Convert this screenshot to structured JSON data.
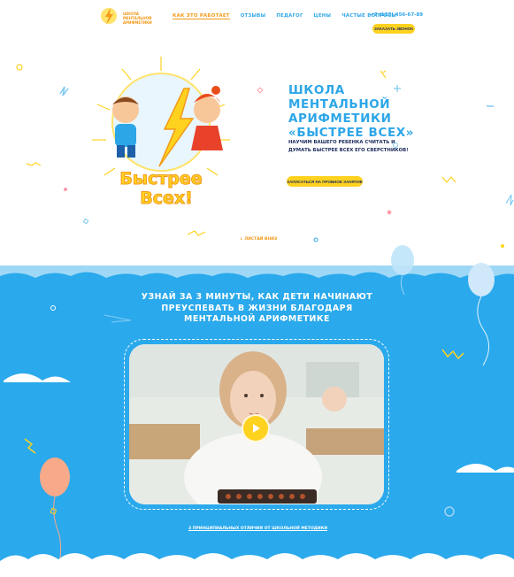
{
  "header": {
    "logo_text": "ШКОЛА МЕНТАЛЬНОЙ АРИФМЕТИКИ",
    "nav": [
      {
        "label": "Как это работает",
        "active": true
      },
      {
        "label": "Отзывы",
        "active": false
      },
      {
        "label": "Педагог",
        "active": false
      },
      {
        "label": "Цены",
        "active": false
      },
      {
        "label": "Частые вопросы",
        "active": false
      }
    ],
    "phone": "+7 (123) 456-67-89",
    "call_button": "Заказать звонок"
  },
  "hero": {
    "brand_logo_text": "Быстрее Всех!",
    "title": "ШКОЛА МЕНТАЛЬНОЙ АРИФМЕТИКИ «БЫСТРЕЕ ВСЕХ»",
    "subtitle": "НАУЧИМ ВАШЕГО РЕБЕНКА СЧИТАТЬ И ДУМАТЬ БЫСТРЕЕ ВСЕХ ЕГО СВЕРСТНИКОВ!",
    "cta": "ЗАПИСАТЬСЯ НА ПРОБНОЕ ЗАНЯТИЕ",
    "scroll_link": "Листай вниз"
  },
  "video_section": {
    "title": "УЗНАЙ ЗА 3 МИНУТЫ, КАК ДЕТИ НАЧИНАЮТ ПРЕУСПЕВАТЬ В ЖИЗНИ БЛАГОДАРЯ МЕНТАЛЬНОЙ АРИФМЕТИКЕ",
    "bottom_link": "3 принципиальных отличия от школьной методики"
  },
  "colors": {
    "accent_blue": "#2da6e8",
    "section_blue": "#2aa9ec",
    "accent_yellow": "#ffd21f",
    "accent_orange": "#f39a1a",
    "dark_text": "#1d2b5c"
  },
  "icons": [
    "logo-lightning-icon",
    "arrow-down-icon",
    "play-icon",
    "balloon-icon",
    "cloud-icon"
  ]
}
